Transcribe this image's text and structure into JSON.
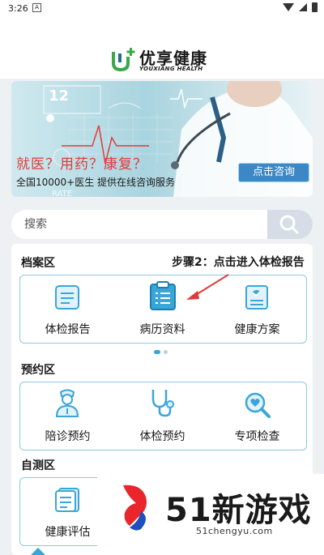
{
  "status_bar": {
    "time": "3:26",
    "notification_icon": "A"
  },
  "header": {
    "brand_name": "优享健康",
    "brand_subtitle": "YOUXIANG HEALTH"
  },
  "banner": {
    "headline": "就医？用药？康复？",
    "description": "全国10000+医生  提供在线咨询服务",
    "consult_button": "点击咨询",
    "dashboard_readout": "12",
    "chart_label": "RATE"
  },
  "search": {
    "placeholder": "搜索"
  },
  "archive": {
    "title": "档案区",
    "step_hint": "步骤2：点击进入体检报告",
    "items": [
      {
        "label": "体检报告",
        "icon": "report-icon"
      },
      {
        "label": "病历资料",
        "icon": "clipboard-icon"
      },
      {
        "label": "健康方案",
        "icon": "health-plan-icon"
      }
    ]
  },
  "appointment": {
    "title": "预约区",
    "items": [
      {
        "label": "陪诊预约",
        "icon": "nurse-icon"
      },
      {
        "label": "体检预约",
        "icon": "stethoscope-icon"
      },
      {
        "label": "专项检查",
        "icon": "magnifier-heart-icon"
      }
    ]
  },
  "self_test": {
    "title": "自测区",
    "items": [
      {
        "label": "健康评估",
        "icon": "assessment-icon"
      }
    ]
  },
  "watermark": {
    "text": "51新游戏",
    "url": "51chengyu.com"
  },
  "colors": {
    "accent": "#3aa6d8",
    "banner_red": "#e23a3a",
    "button_blue": "#3c88c7",
    "border": "#8ec8e4"
  }
}
